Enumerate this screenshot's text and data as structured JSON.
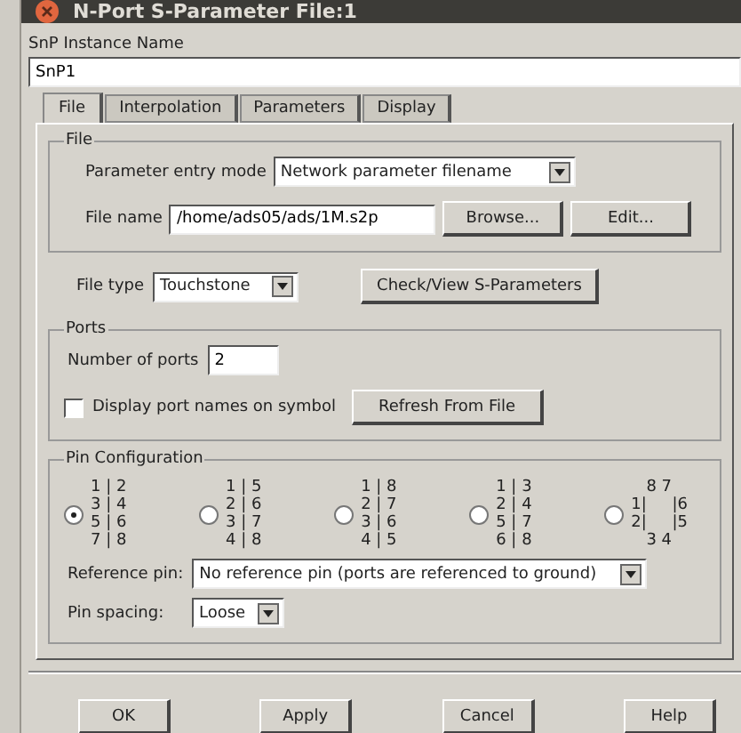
{
  "window": {
    "title": "N-Port S-Parameter File:1"
  },
  "instance": {
    "label": "SnP Instance Name",
    "value": "SnP1"
  },
  "tabs": [
    {
      "label": "File",
      "selected": true
    },
    {
      "label": "Interpolation",
      "selected": false
    },
    {
      "label": "Parameters",
      "selected": false
    },
    {
      "label": "Display",
      "selected": false
    }
  ],
  "file_group": {
    "title": "File",
    "entry_mode_label": "Parameter entry mode",
    "entry_mode_value": "Network parameter filename",
    "file_name_label": "File name",
    "file_name_value": "/home/ads05/ads/1M.s2p",
    "buttons": [
      "Browse...",
      "Edit..."
    ]
  },
  "file_type": {
    "label": "File type",
    "value": "Touchstone",
    "button": "Check/View S-Parameters"
  },
  "ports": {
    "title": "Ports",
    "count_label": "Number of ports",
    "count_value": "2",
    "display_names_label": "Display port names on symbol",
    "display_names_checked": false,
    "button": "Refresh From File"
  },
  "pin_configuration": {
    "title": "Pin Configuration",
    "options": [
      {
        "lines": [
          "1 | 2",
          "3 | 4",
          "5 | 6",
          "7 | 8"
        ],
        "selected": true
      },
      {
        "lines": [
          "1 | 5",
          "2 | 6",
          "3 | 7",
          "4 | 8"
        ],
        "selected": false
      },
      {
        "lines": [
          "1 | 8",
          "2 | 7",
          "3 | 6",
          "4 | 5"
        ],
        "selected": false
      },
      {
        "lines": [
          "1 | 3",
          "2 | 4",
          "5 | 7",
          "6 | 8"
        ],
        "selected": false
      },
      {
        "lines": [
          "   8 7",
          "1|     |6",
          "2|     |5",
          "   3 4"
        ],
        "selected": false
      }
    ],
    "reference_pin_label": "Reference pin:",
    "reference_pin_value": "No reference pin (ports are referenced to ground)",
    "pin_spacing_label": "Pin spacing:",
    "pin_spacing_value": "Loose"
  },
  "buttons": [
    "OK",
    "Apply",
    "Cancel",
    "Help"
  ]
}
